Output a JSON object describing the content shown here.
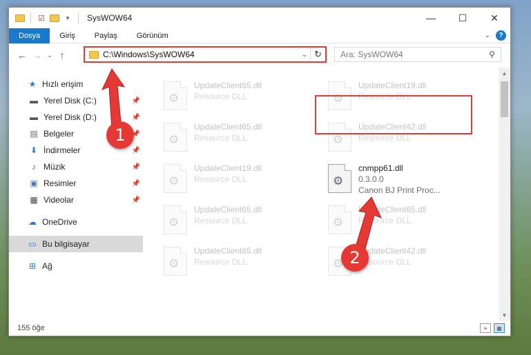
{
  "window": {
    "title": "SysWOW64",
    "controls": {
      "minimize": "—",
      "maximize": "☐",
      "close": "✕"
    }
  },
  "ribbon": {
    "tabs": [
      "Dosya",
      "Giriş",
      "Paylaş",
      "Görünüm"
    ],
    "help": "?"
  },
  "navigation": {
    "address": "C:\\Windows\\SysWOW64",
    "search_placeholder": "Ara: SysWOW64"
  },
  "sidebar": {
    "quick_access": "Hızlı erişim",
    "items": [
      {
        "label": "Yerel Disk (C:)",
        "icon": "drive-icon",
        "pinned": true
      },
      {
        "label": "Yerel Disk (D:)",
        "icon": "drive-icon",
        "pinned": true
      },
      {
        "label": "Belgeler",
        "icon": "documents-icon",
        "pinned": true
      },
      {
        "label": "İndirmeler",
        "icon": "download-icon",
        "pinned": true
      },
      {
        "label": "Müzik",
        "icon": "music-icon",
        "pinned": true
      },
      {
        "label": "Resimler",
        "icon": "pictures-icon",
        "pinned": true
      },
      {
        "label": "Videolar",
        "icon": "videos-icon",
        "pinned": true
      }
    ],
    "onedrive": "OneDrive",
    "this_pc": "Bu bilgisayar",
    "network": "Ağ"
  },
  "files": [
    {
      "name": "UpdateClient65.dll",
      "desc": "Resource DLL"
    },
    {
      "name": "UpdateClient19.dll",
      "desc": "Resource DLL"
    },
    {
      "name": "UpdateClient65.dll",
      "desc": "Resource DLL"
    },
    {
      "name": "UpdateClient42.dll",
      "desc": "Resource DLL"
    },
    {
      "name": "UpdateClient19.dll",
      "desc": "Resource DLL"
    },
    {
      "name": "cnmpp61.dll",
      "version": "0.3.0.0",
      "desc": "Canon BJ Print Proc..."
    },
    {
      "name": "UpdateClient65.dll",
      "desc": "Resource DLL"
    },
    {
      "name": "UpdateClient65.dll",
      "desc": "Resource DLL"
    },
    {
      "name": "UpdateClient65.dll",
      "desc": "Resource DLL"
    },
    {
      "name": "UpdateClient42.dll",
      "desc": "Resource DLL"
    }
  ],
  "status": {
    "count": "155 öğe"
  },
  "annotations": {
    "step1": "1",
    "step2": "2",
    "color": "#e53935"
  }
}
